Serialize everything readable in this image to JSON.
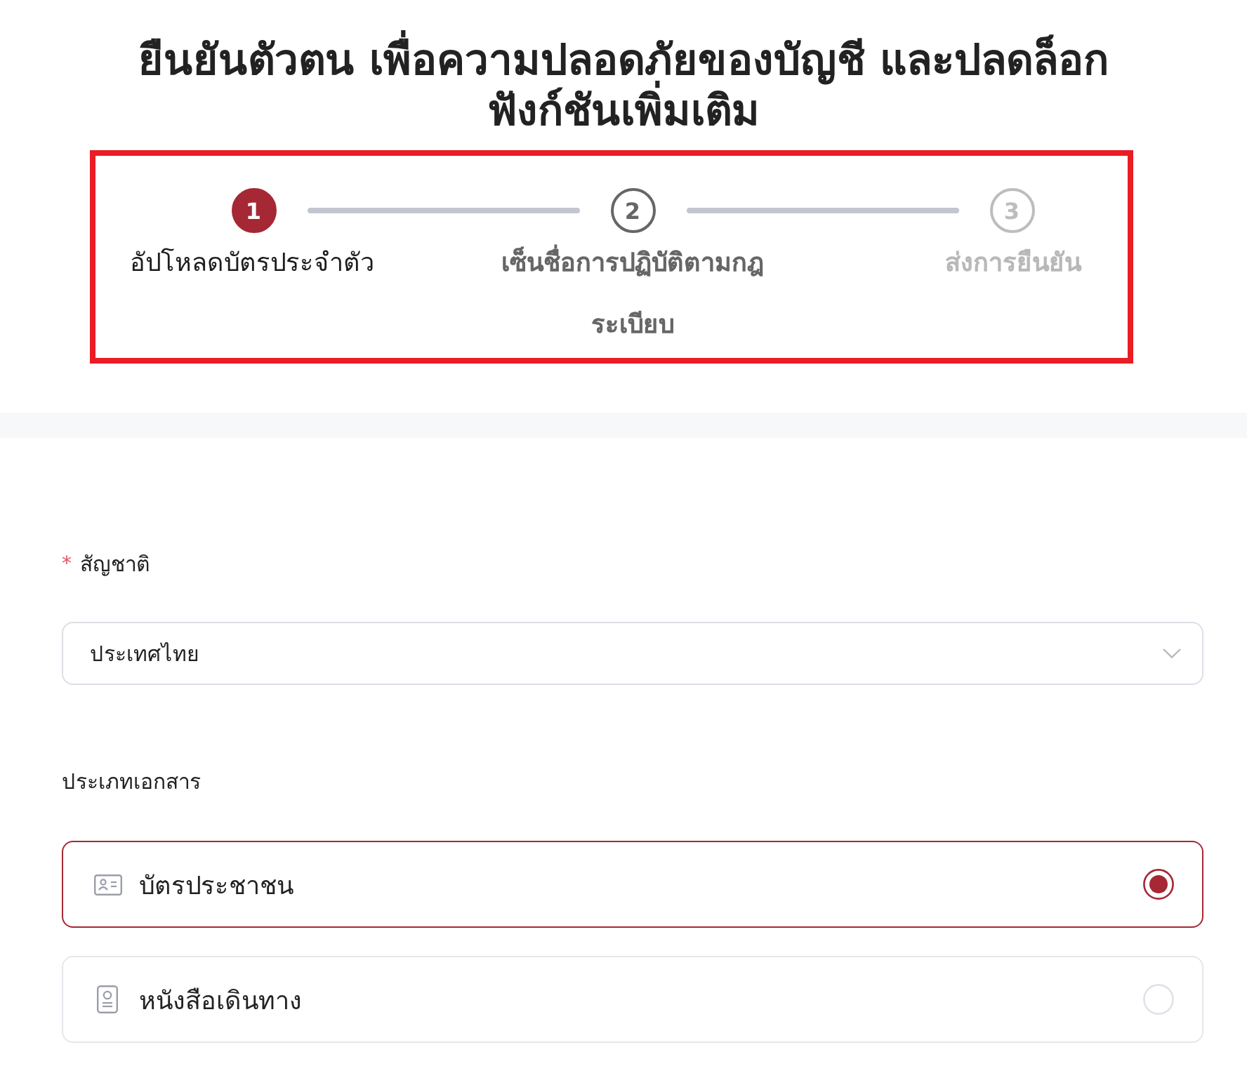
{
  "title": "ยืนยันตัวตน เพื่อความปลอดภัยของบัญชี และปลดล็อกฟังก์ชันเพิ่มเติม",
  "steps": [
    {
      "number": "1",
      "label": "อัปโหลดบัตรประจำตัว",
      "selected": true,
      "disabled": false
    },
    {
      "number": "2",
      "label": "เซ็นชื่อการปฏิบัติตามกฎระเบียบ",
      "selected": false,
      "disabled": false
    },
    {
      "number": "3",
      "label": "ส่งการยืนยัน",
      "selected": false,
      "disabled": true
    }
  ],
  "nationality": {
    "required_mark": "*",
    "label": "สัญชาติ",
    "value": "ประเทศไทย"
  },
  "document_type": {
    "label": "ประเภทเอกสาร",
    "options": [
      {
        "kind": "id_card",
        "label": "บัตรประชาชน",
        "selected": true
      },
      {
        "kind": "passport",
        "label": "หนังสือเดินทาง",
        "selected": false
      }
    ]
  }
}
